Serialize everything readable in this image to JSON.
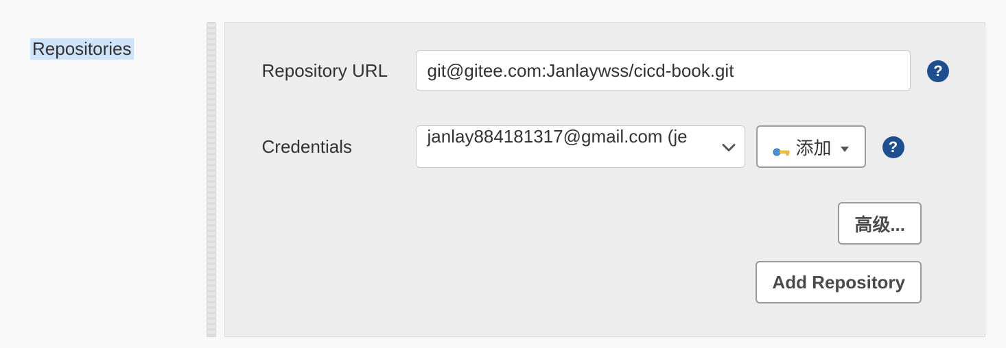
{
  "section_label": "Repositories",
  "fields": {
    "repo_url": {
      "label": "Repository URL",
      "value": "git@gitee.com:Janlaywss/cicd-book.git"
    },
    "credentials": {
      "label": "Credentials",
      "selected": "janlay884181317@gmail.com (je",
      "add_button": "添加"
    }
  },
  "buttons": {
    "advanced": "高级...",
    "add_repo": "Add Repository"
  },
  "help_glyph": "?"
}
